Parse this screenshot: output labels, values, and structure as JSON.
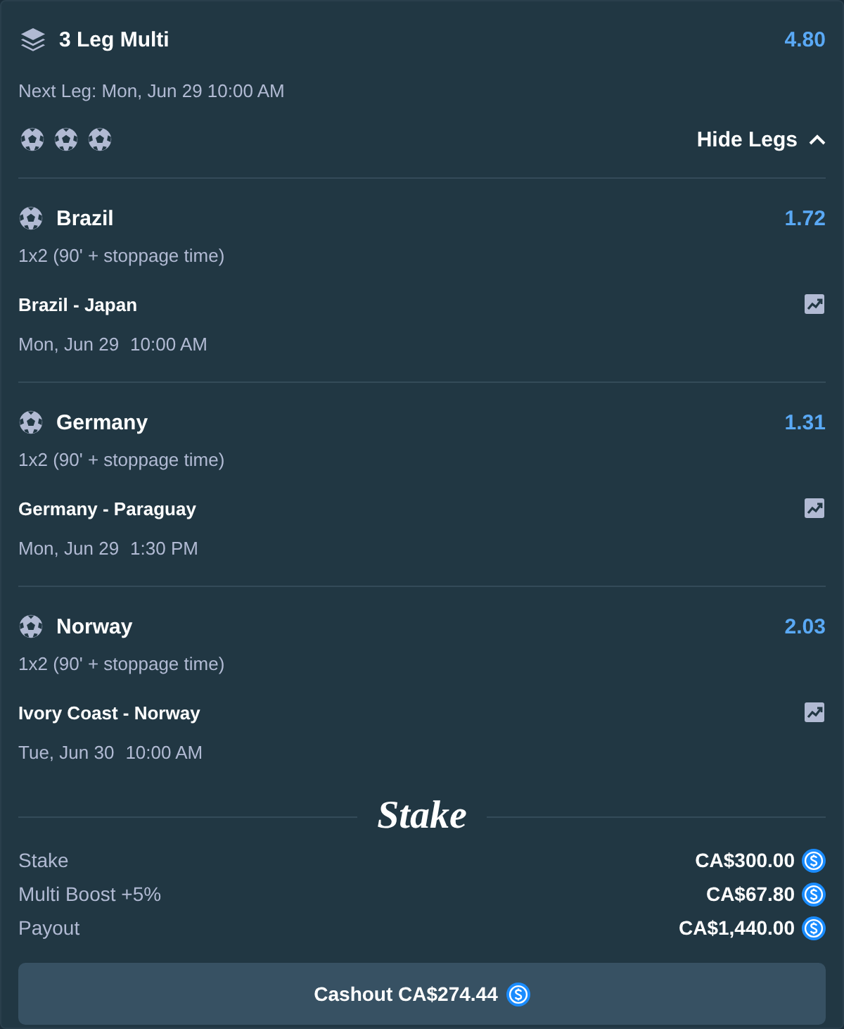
{
  "bet": {
    "title": "3 Leg Multi",
    "odds": "4.80",
    "next_leg": "Next Leg: Mon, Jun 29 10:00 AM",
    "toggle": {
      "label": "Hide Legs",
      "expanded": true
    }
  },
  "legs": [
    {
      "selection": "Brazil",
      "odds": "1.72",
      "market": "1x2 (90' + stoppage time)",
      "match": "Brazil - Japan",
      "date": "Mon, Jun 29",
      "time": "10:00 AM"
    },
    {
      "selection": "Germany",
      "odds": "1.31",
      "market": "1x2 (90' + stoppage time)",
      "match": "Germany - Paraguay",
      "date": "Mon, Jun 29",
      "time": "1:30 PM"
    },
    {
      "selection": "Norway",
      "odds": "2.03",
      "market": "1x2 (90' + stoppage time)",
      "match": "Ivory Coast - Norway",
      "date": "Tue, Jun 30",
      "time": "10:00 AM"
    }
  ],
  "logo": "Stake",
  "summary": [
    {
      "label": "Stake",
      "amount": "CA$300.00"
    },
    {
      "label": "Multi Boost +5%",
      "amount": "CA$67.80"
    },
    {
      "label": "Payout",
      "amount": "CA$1,440.00"
    }
  ],
  "cashout": {
    "label": "Cashout CA$274.44"
  }
}
